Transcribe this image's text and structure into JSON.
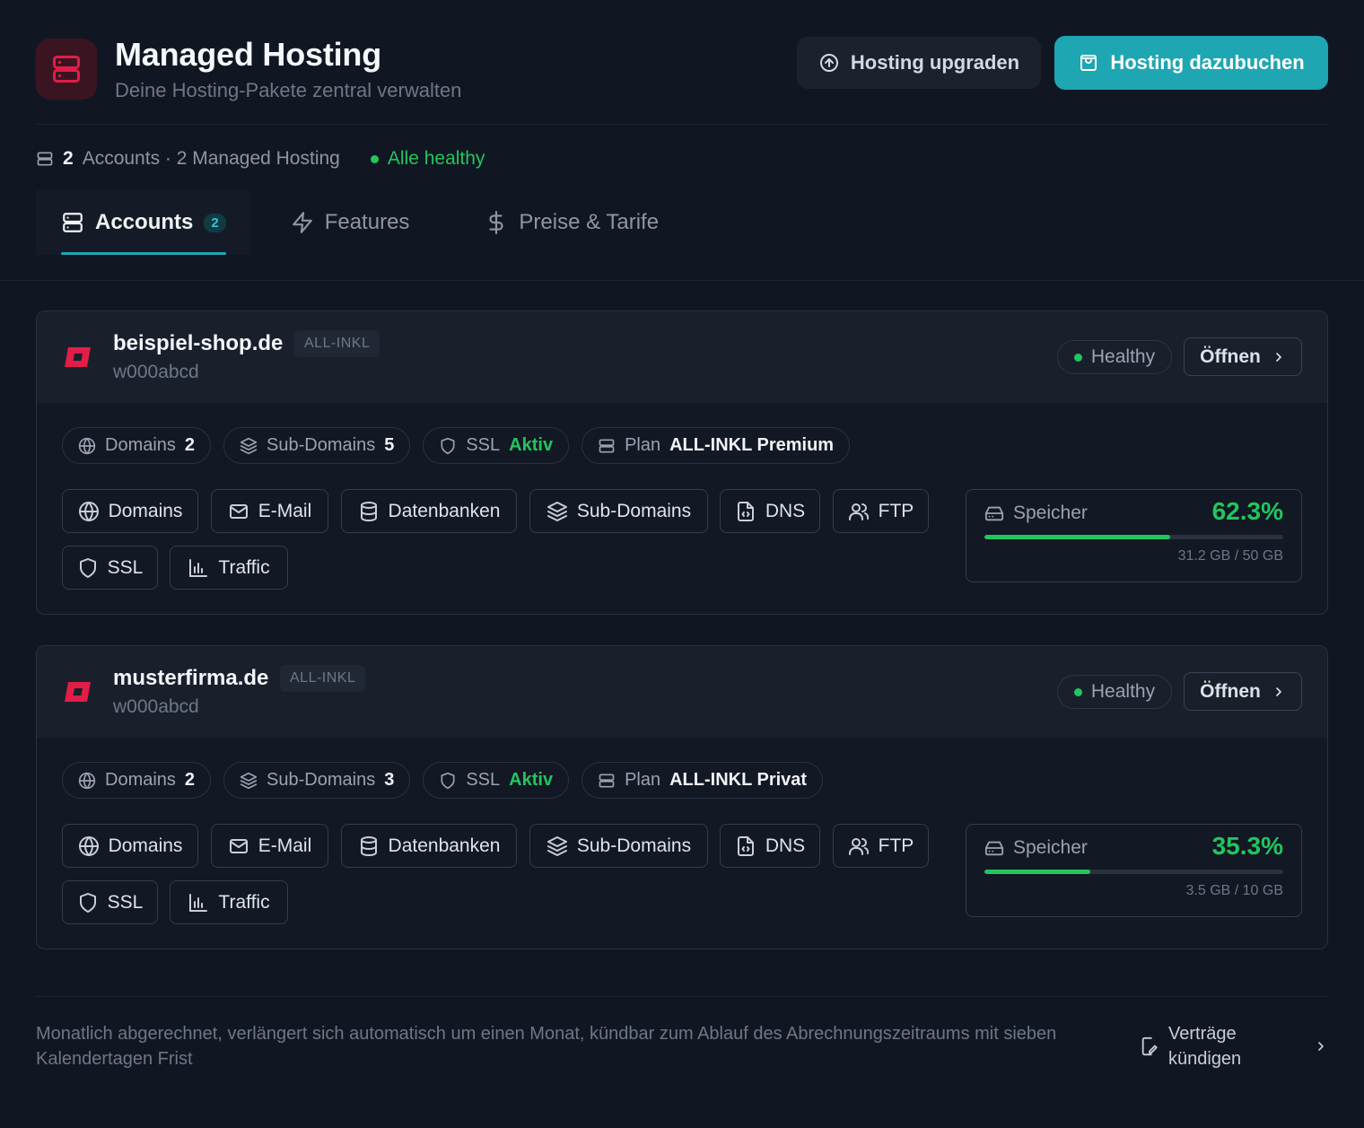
{
  "header": {
    "title": "Managed Hosting",
    "subtitle": "Deine Hosting-Pakete zentral verwalten",
    "upgrade_label": "Hosting upgraden",
    "book_label": "Hosting dazubuchen"
  },
  "summary": {
    "count": "2",
    "text": "Accounts · 2 Managed Hosting",
    "health": "Alle healthy"
  },
  "tabs": [
    {
      "label": "Accounts",
      "badge": "2",
      "active": true
    },
    {
      "label": "Features"
    },
    {
      "label": "Preise & Tarife"
    }
  ],
  "accounts": [
    {
      "domain": "beispiel-shop.de",
      "provider": "ALL-INKL",
      "account_id": "w000abcd",
      "status": "Healthy",
      "open_label": "Öffnen",
      "chips": {
        "domains_label": "Domains",
        "domains_value": "2",
        "subdomains_label": "Sub-Domains",
        "subdomains_value": "5",
        "ssl_label": "SSL",
        "ssl_value": "Aktiv",
        "plan_label": "Plan",
        "plan_value": "ALL-INKL Premium"
      },
      "actions": [
        "Domains",
        "E-Mail",
        "Datenbanken",
        "Sub-Domains",
        "DNS",
        "FTP",
        "SSL",
        "Traffic"
      ],
      "storage": {
        "label": "Speicher",
        "percent": "62.3%",
        "fraction": 0.623,
        "usage": "31.2 GB / 50 GB"
      }
    },
    {
      "domain": "musterfirma.de",
      "provider": "ALL-INKL",
      "account_id": "w000abcd",
      "status": "Healthy",
      "open_label": "Öffnen",
      "chips": {
        "domains_label": "Domains",
        "domains_value": "2",
        "subdomains_label": "Sub-Domains",
        "subdomains_value": "3",
        "ssl_label": "SSL",
        "ssl_value": "Aktiv",
        "plan_label": "Plan",
        "plan_value": "ALL-INKL Privat"
      },
      "actions": [
        "Domains",
        "E-Mail",
        "Datenbanken",
        "Sub-Domains",
        "DNS",
        "FTP",
        "SSL",
        "Traffic"
      ],
      "storage": {
        "label": "Speicher",
        "percent": "35.3%",
        "fraction": 0.353,
        "usage": "3.5 GB / 10 GB"
      }
    }
  ],
  "footer": {
    "note": "Monatlich abgerechnet, verlängert sich automatisch um einen Monat, kündbar zum Ablauf des Abrechnungszeitraums mit sieben Kalendertagen Frist",
    "cancel_label": "Verträge kündigen"
  },
  "colors": {
    "background": "#111722",
    "accent": "#1fa6b3",
    "success": "#22c55e",
    "brand_red": "#e11d48"
  },
  "icons": {
    "app": "server-icon",
    "upgrade": "arrow-up-circle-icon",
    "book": "shopping-bag-icon",
    "provider_logo": "all-inkl-logo"
  }
}
